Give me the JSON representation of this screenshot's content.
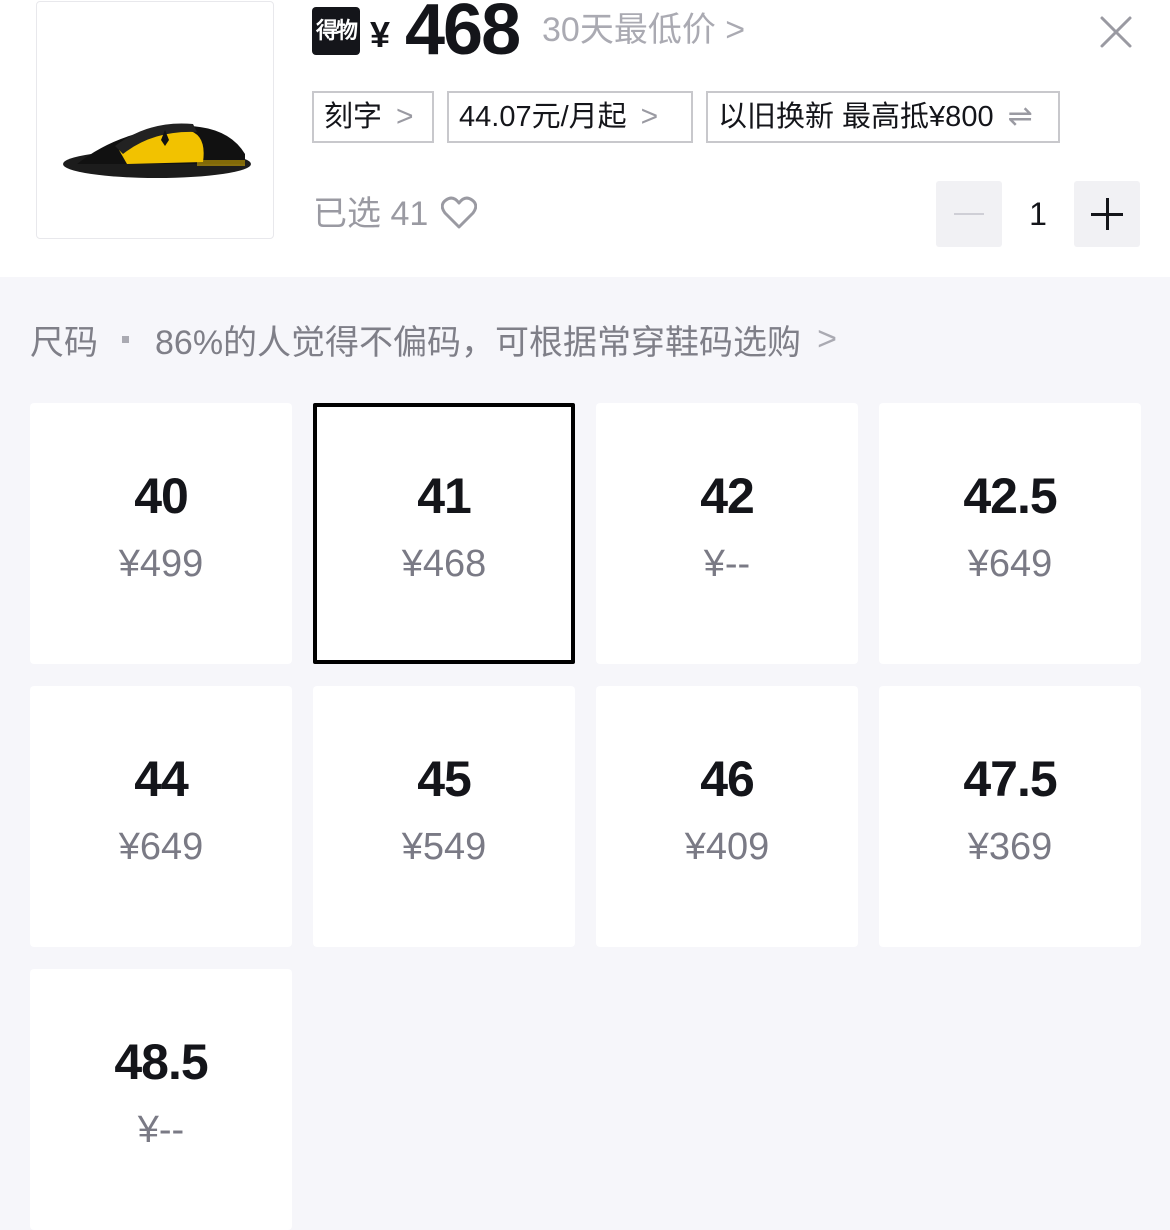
{
  "product": {
    "brand_logo_text": "得物",
    "currency": "¥",
    "price": "468",
    "lowest_30_label": "30天最低价 >",
    "tags": [
      {
        "label": "刻字",
        "suffix": ">"
      },
      {
        "label": "44.07元/月起",
        "suffix": ">"
      },
      {
        "label": "以旧换新 最高抵¥800",
        "suffix": "⇌"
      }
    ],
    "selected_label": "已选 41",
    "quantity": "1"
  },
  "size_section": {
    "title": "尺码",
    "hint": "86%的人觉得不偏码，可根据常穿鞋码选购",
    "chevron": ">"
  },
  "sizes": [
    {
      "size": "40",
      "price": "¥499"
    },
    {
      "size": "41",
      "price": "¥468",
      "selected": true
    },
    {
      "size": "42",
      "price": "¥--"
    },
    {
      "size": "42.5",
      "price": "¥649"
    },
    {
      "size": "44",
      "price": "¥649"
    },
    {
      "size": "45",
      "price": "¥549"
    },
    {
      "size": "46",
      "price": "¥409"
    },
    {
      "size": "47.5",
      "price": "¥369"
    },
    {
      "size": "48.5",
      "price": "¥--"
    }
  ],
  "colors": {
    "text_primary": "#14151a",
    "text_secondary": "#9a9aa2",
    "page_bg": "#f6f6fa",
    "selected_border": "#000000",
    "product_accent": "#f2c200"
  }
}
